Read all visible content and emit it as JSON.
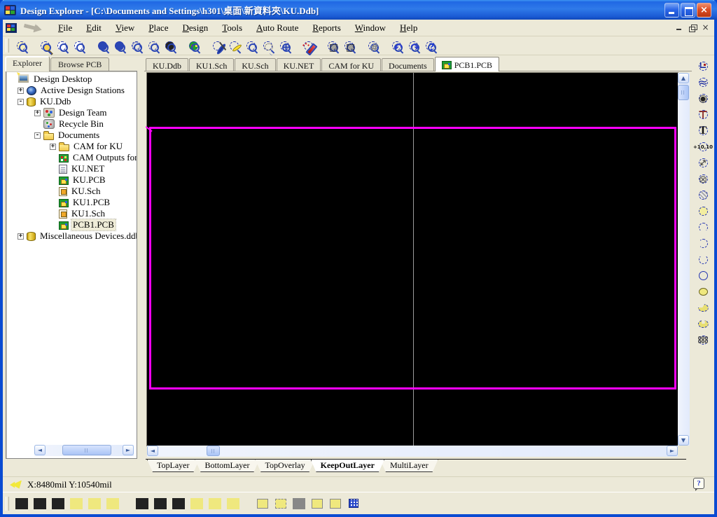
{
  "window": {
    "title": "Design Explorer - [C:\\Documents and Settings\\h301\\桌面\\新資料夾\\KU.Ddb]",
    "titlebar_icons": [
      "app-icon",
      "minimize-icon",
      "maximize-icon",
      "close-icon"
    ],
    "mdi_icons": [
      "mdi-minimize-icon",
      "mdi-restore-icon",
      "mdi-close-icon"
    ]
  },
  "menu": {
    "items": [
      "File",
      "Edit",
      "View",
      "Place",
      "Design",
      "Tools",
      "Auto Route",
      "Reports",
      "Window",
      "Help"
    ]
  },
  "main_toolbar": {
    "icons": [
      "explorer-tree",
      "separator",
      "open-document",
      "save-document",
      "print",
      "separator",
      "zoom-in",
      "zoom-out",
      "zoom-all",
      "zoom-area",
      "zoom-point",
      "separator",
      "browse-board",
      "separator",
      "cross-probe",
      "draw-wire",
      "select-area",
      "move-selection",
      "move-cursor",
      "separator",
      "highlight-net",
      "separator",
      "polygon-pour",
      "polygon-pour-cutout",
      "separator",
      "toggle-grid",
      "separator",
      "undo",
      "redo",
      "help"
    ]
  },
  "explorer": {
    "tabs": [
      {
        "label": "Explorer",
        "active": true
      },
      {
        "label": "Browse PCB",
        "active": false
      }
    ],
    "tree": [
      {
        "label": "Design Desktop",
        "level": 0,
        "toggle": null,
        "icon": "desktop"
      },
      {
        "label": "Active Design Stations",
        "level": 1,
        "toggle": "+",
        "icon": "stations"
      },
      {
        "label": "KU.Ddb",
        "level": 1,
        "toggle": "-",
        "icon": "database"
      },
      {
        "label": "Design Team",
        "level": 2,
        "toggle": "+",
        "icon": "team"
      },
      {
        "label": "Recycle Bin",
        "level": 2,
        "toggle": null,
        "icon": "recycle"
      },
      {
        "label": "Documents",
        "level": 2,
        "toggle": "-",
        "icon": "folder"
      },
      {
        "label": "CAM for KU",
        "level": 3,
        "toggle": "+",
        "icon": "folder"
      },
      {
        "label": "CAM Outputs for KU",
        "level": 3,
        "toggle": null,
        "icon": "cam"
      },
      {
        "label": "KU.NET",
        "level": 3,
        "toggle": null,
        "icon": "net"
      },
      {
        "label": "KU.PCB",
        "level": 3,
        "toggle": null,
        "icon": "pcb"
      },
      {
        "label": "KU.Sch",
        "level": 3,
        "toggle": null,
        "icon": "sch"
      },
      {
        "label": "KU1.PCB",
        "level": 3,
        "toggle": null,
        "icon": "pcb"
      },
      {
        "label": "KU1.Sch",
        "level": 3,
        "toggle": null,
        "icon": "sch"
      },
      {
        "label": "PCB1.PCB",
        "level": 3,
        "toggle": null,
        "icon": "pcb",
        "selected": true
      },
      {
        "label": "Miscellaneous Devices.ddb",
        "level": 1,
        "toggle": "+",
        "icon": "database"
      }
    ]
  },
  "document_tabs": [
    {
      "label": "KU.Ddb"
    },
    {
      "label": "KU1.Sch"
    },
    {
      "label": "KU.Sch"
    },
    {
      "label": "KU.NET"
    },
    {
      "label": "CAM for KU"
    },
    {
      "label": "Documents"
    },
    {
      "label": "PCB1.PCB",
      "active": true,
      "icon": "pcb"
    }
  ],
  "editor": {
    "background": "#000000",
    "board_outline_color": "#FF00FF",
    "grid_line_color": "#9B9B9B"
  },
  "layer_tabs": [
    {
      "label": "TopLayer"
    },
    {
      "label": "BottomLayer"
    },
    {
      "label": "TopOverlay"
    },
    {
      "label": "KeepOutLayer",
      "active": true
    },
    {
      "label": "MultiLayer"
    }
  ],
  "placement_toolbar": {
    "coordinate_text": "+10,10",
    "icons": [
      "interactive-routing",
      "multiple-traces",
      "pad",
      "via",
      "string",
      "coordinate",
      "dimension",
      "arc-edge",
      "fill-hatch",
      "component",
      "arc-center",
      "arc-any",
      "arc-45",
      "full-circle",
      "fill",
      "polygon-plane",
      "split-plane",
      "pad-array"
    ]
  },
  "status_bar": {
    "coordinates": "X:8480mil Y:10540mil",
    "icons": [
      "cursor-arrow",
      "cursor-arrow-gray",
      "help-balloon"
    ]
  },
  "alignment_toolbar": {
    "icons": [
      "align-left",
      "center-horizontal",
      "align-right",
      "equal-horizontal-spacing",
      "increase-horizontal-spacing",
      "decrease-horizontal-spacing",
      "separator",
      "align-top",
      "center-vertical",
      "align-bottom",
      "equal-vertical-spacing",
      "increase-vertical-spacing",
      "decrease-vertical-spacing",
      "separator",
      "arrange-within-room",
      "arrange-outside-board",
      "align-to-grid",
      "shove",
      "set-shove-depth",
      "placement-grid"
    ]
  }
}
